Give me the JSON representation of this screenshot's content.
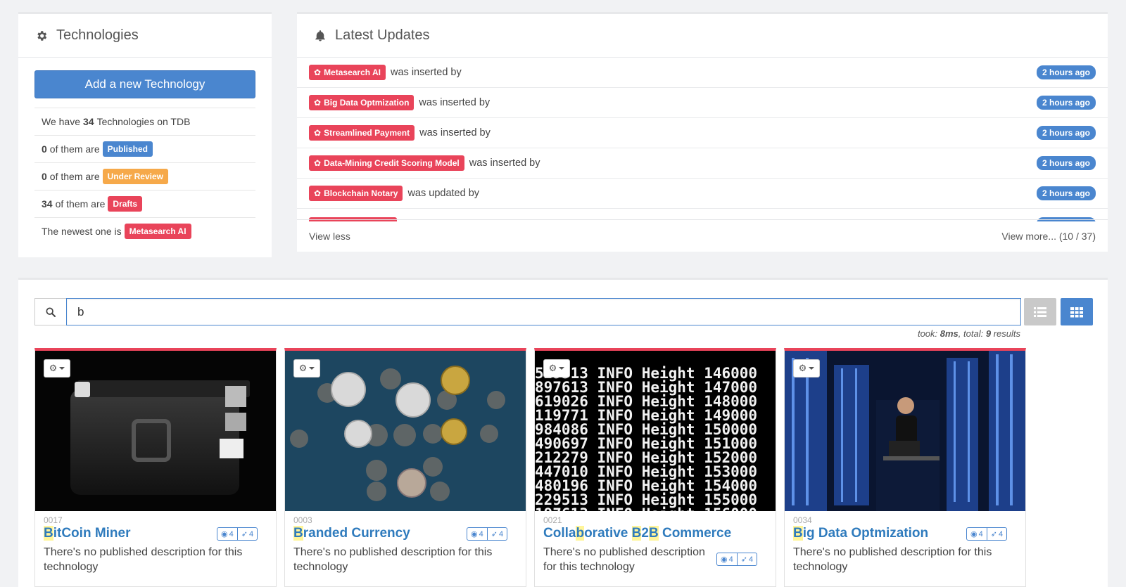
{
  "technologies": {
    "title": "Technologies",
    "add_button": "Add a new Technology",
    "total_prefix": "We have",
    "total_count": "34",
    "total_suffix": "Technologies on TDB",
    "published_count": "0",
    "published_text": "of them are",
    "published_label": "Published",
    "review_count": "0",
    "review_text": "of them are",
    "review_label": "Under Review",
    "drafts_count": "34",
    "drafts_text": "of them are",
    "drafts_label": "Drafts",
    "newest_text": "The newest one is",
    "newest_label": "Metasearch AI"
  },
  "updates": {
    "title": "Latest Updates",
    "items": [
      {
        "tech": "Metasearch AI",
        "action": "was inserted by",
        "time": "2 hours ago"
      },
      {
        "tech": "Big Data Optmization",
        "action": "was inserted by",
        "time": "2 hours ago"
      },
      {
        "tech": "Streamlined Payment",
        "action": "was inserted by",
        "time": "2 hours ago"
      },
      {
        "tech": "Data-Mining Credit Scoring Model",
        "action": "was inserted by",
        "time": "2 hours ago"
      },
      {
        "tech": "Blockchain Notary",
        "action": "was updated by",
        "time": "2 hours ago"
      },
      {
        "tech": "",
        "action": "",
        "time": ""
      }
    ],
    "view_less": "View less",
    "view_more": "View more... (10 / 37)"
  },
  "search": {
    "query": "b",
    "took_prefix": "took:",
    "took_value": "8ms",
    "total_prefix": ", total:",
    "total_value": "9",
    "total_suffix": "results"
  },
  "cards": [
    {
      "id": "0017",
      "title_hl": "B",
      "title_rest": "itCoin Miner",
      "desc": "There's no published description for this technology",
      "stat1": "4",
      "stat2": "4"
    },
    {
      "id": "0003",
      "title_hl": "B",
      "title_rest": "randed Currency",
      "desc": "There's no published description for this technology",
      "stat1": "4",
      "stat2": "4"
    },
    {
      "id": "0021",
      "title_a": "Colla",
      "title_b": "b",
      "title_c": "orative ",
      "title_d": "B",
      "title_e": "2",
      "title_f": "B",
      "title_g": " Commerce",
      "desc": "There's no published description for this technology",
      "stat1": "4",
      "stat2": "4"
    },
    {
      "id": "0034",
      "title_hl": "B",
      "title_rest": "ig Data Optmization",
      "desc": "There's no published description for this technology",
      "stat1": "4",
      "stat2": "4"
    }
  ],
  "colors": {
    "primary": "#4a86cf",
    "danger": "#e9445a",
    "warning": "#f6a94a",
    "link": "#2f7bbd"
  }
}
